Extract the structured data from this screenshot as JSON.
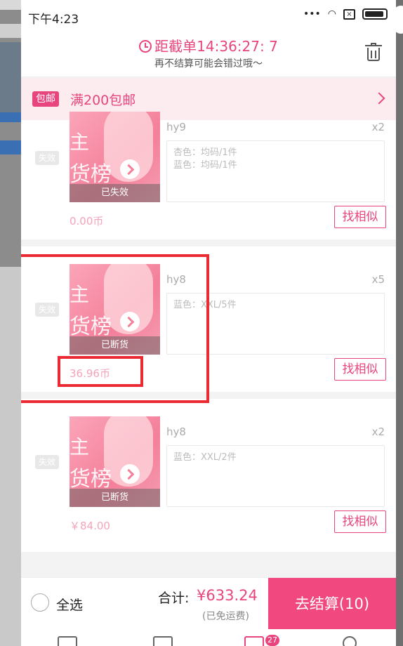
{
  "status_bar": {
    "time": "下午4:23"
  },
  "header": {
    "deadline": "距截单14:36:27: 7",
    "subtitle": "再不结算可能会错过哦～"
  },
  "shipping": {
    "badge": "包邮",
    "text": "满200包邮"
  },
  "items": [
    {
      "tag": "失效",
      "name": "hy9",
      "qty": "x2",
      "status": "已失效",
      "thumb_text_1": "主",
      "thumb_text_2": "货榜",
      "specs": [
        "杏色：均码/1件",
        "蓝色：均码/1件"
      ],
      "price": "0.00币",
      "button": "找相似"
    },
    {
      "tag": "失效",
      "name": "hy8",
      "qty": "x5",
      "status": "已断货",
      "thumb_text_1": "主",
      "thumb_text_2": "货榜",
      "specs": [
        "蓝色：XXL/5件"
      ],
      "price": "36.96币",
      "button": "找相似"
    },
    {
      "tag": "失效",
      "name": "hy8",
      "qty": "x2",
      "status": "已断货",
      "thumb_text_1": "主",
      "thumb_text_2": "货榜",
      "specs": [
        "蓝色：XXL/2件"
      ],
      "price": "￥84.00",
      "button": "找相似"
    }
  ],
  "footer": {
    "select_all": "全选",
    "total_label": "合计:",
    "total_value": "¥633.24",
    "free_shipping": "(已免运费)",
    "checkout": "去结算(10)"
  },
  "tabbar": {
    "cart_badge": "27"
  },
  "colors": {
    "accent": "#e8457e",
    "highlight": "#ec2a34"
  }
}
